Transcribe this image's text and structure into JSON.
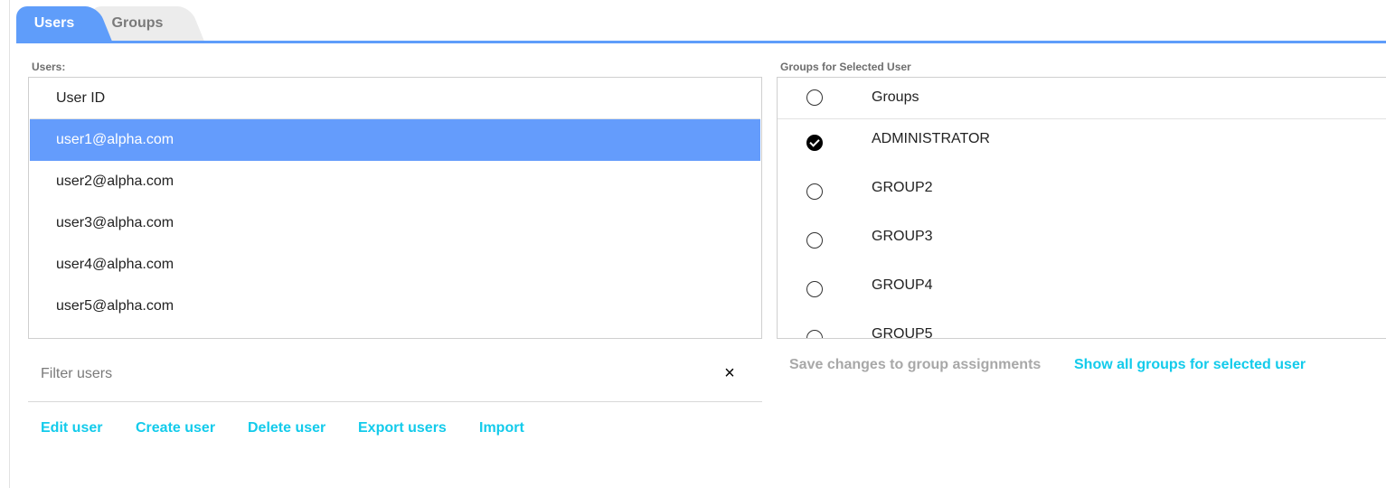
{
  "tabs": [
    {
      "label": "Users",
      "active": true
    },
    {
      "label": "Groups",
      "active": false
    }
  ],
  "users_section": {
    "label": "Users:",
    "column_header": "User ID",
    "rows": [
      {
        "id": "user1@alpha.com",
        "selected": true
      },
      {
        "id": "user2@alpha.com",
        "selected": false
      },
      {
        "id": "user3@alpha.com",
        "selected": false
      },
      {
        "id": "user4@alpha.com",
        "selected": false
      },
      {
        "id": "user5@alpha.com",
        "selected": false
      }
    ]
  },
  "groups_section": {
    "label": "Groups for Selected User",
    "column_header": "Groups",
    "rows": [
      {
        "name": "ADMINISTRATOR",
        "checked": true
      },
      {
        "name": "GROUP2",
        "checked": false
      },
      {
        "name": "GROUP3",
        "checked": false
      },
      {
        "name": "GROUP4",
        "checked": false
      },
      {
        "name": "GROUP5",
        "checked": false
      }
    ]
  },
  "filter": {
    "placeholder": "Filter users",
    "value": "",
    "clear_icon": "×"
  },
  "user_actions": {
    "edit": "Edit user",
    "create": "Create user",
    "delete": "Delete user",
    "export": "Export users",
    "import": "Import"
  },
  "group_actions": {
    "save": "Save changes to group assignments",
    "show_all": "Show all groups for selected user"
  },
  "colors": {
    "accent": "#5f9dfa",
    "link": "#13cbeb",
    "disabled": "#a8a8a8",
    "selected_row": "#649cfc"
  }
}
